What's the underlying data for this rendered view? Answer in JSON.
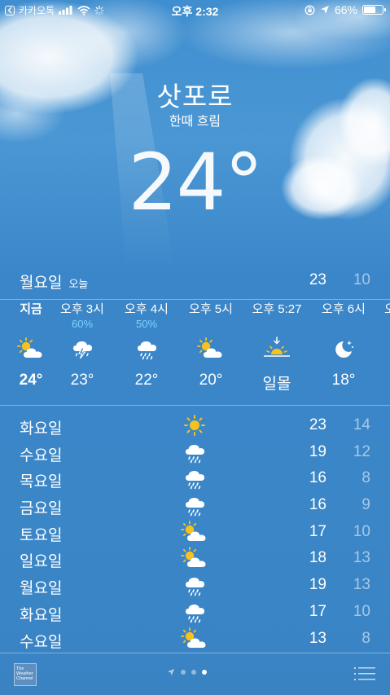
{
  "status_bar": {
    "back_app": "카카오톡",
    "time": "오후 2:32",
    "battery": "66%",
    "battery_level": 0.66
  },
  "location": {
    "city": "삿포로",
    "condition": "한때 흐림",
    "temperature": "24°"
  },
  "today": {
    "day": "월요일",
    "label": "오늘",
    "high": "23",
    "low": "10"
  },
  "hourly": [
    {
      "time": "지금",
      "pop": "",
      "icon": "partly-sunny-icon",
      "temp": "24°"
    },
    {
      "time": "오후 3시",
      "pop": "60%",
      "icon": "thunderstorm-icon",
      "temp": "23°"
    },
    {
      "time": "오후 4시",
      "pop": "50%",
      "icon": "rain-cloud-icon",
      "temp": "22°"
    },
    {
      "time": "오후 5시",
      "pop": "",
      "icon": "partly-sunny-icon",
      "temp": "20°"
    },
    {
      "time": "오후 5:27",
      "pop": "",
      "icon": "sunset-icon",
      "temp": "일몰"
    },
    {
      "time": "오후 6시",
      "pop": "",
      "icon": "moon-stars-icon",
      "temp": "18°"
    }
  ],
  "daily": [
    {
      "day": "화요일",
      "icon": "sun-icon",
      "high": "23",
      "low": "14"
    },
    {
      "day": "수요일",
      "icon": "rain-cloud-icon",
      "high": "19",
      "low": "12"
    },
    {
      "day": "목요일",
      "icon": "rain-cloud-icon",
      "high": "16",
      "low": "8"
    },
    {
      "day": "금요일",
      "icon": "rain-cloud-icon",
      "high": "16",
      "low": "9"
    },
    {
      "day": "토요일",
      "icon": "partly-sunny-icon",
      "high": "17",
      "low": "10"
    },
    {
      "day": "일요일",
      "icon": "partly-sunny-icon",
      "high": "18",
      "low": "13"
    },
    {
      "day": "월요일",
      "icon": "rain-cloud-icon",
      "high": "19",
      "low": "13"
    },
    {
      "day": "화요일",
      "icon": "rain-cloud-icon",
      "high": "17",
      "low": "10"
    },
    {
      "day": "수요일",
      "icon": "partly-sunny-icon",
      "high": "13",
      "low": "8"
    }
  ],
  "bottom_bar": {
    "provider_logo_text": "The Weather Channel",
    "pages": 4,
    "active_page": 3
  },
  "colors": {
    "sun": "#f7c21d",
    "pop_text": "#7fd3ff"
  }
}
